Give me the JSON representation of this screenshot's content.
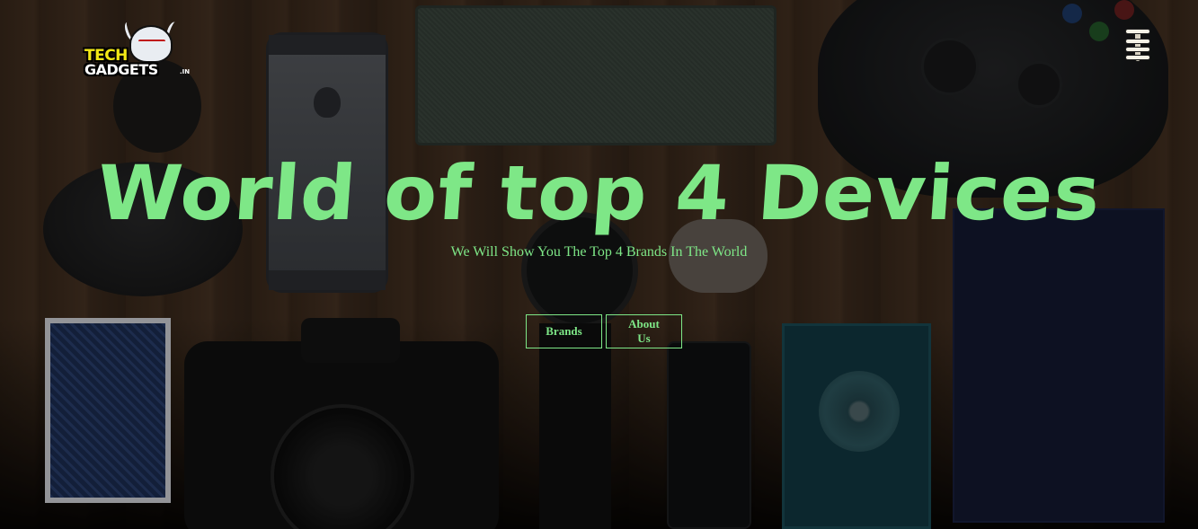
{
  "header": {
    "logo": {
      "line1": "TECH",
      "line2": "GADGETS",
      "suffix": ".IN"
    },
    "menu_icon": "hamburger-menu-icon"
  },
  "hero": {
    "title": "World of top 4 Devices",
    "subtitle": "We Will Show You The Top 4 Brands In The World",
    "buttons": {
      "brands": "Brands",
      "about": "About Us"
    }
  },
  "colors": {
    "accent": "#7ee787",
    "logo_yellow": "#f2e816"
  }
}
